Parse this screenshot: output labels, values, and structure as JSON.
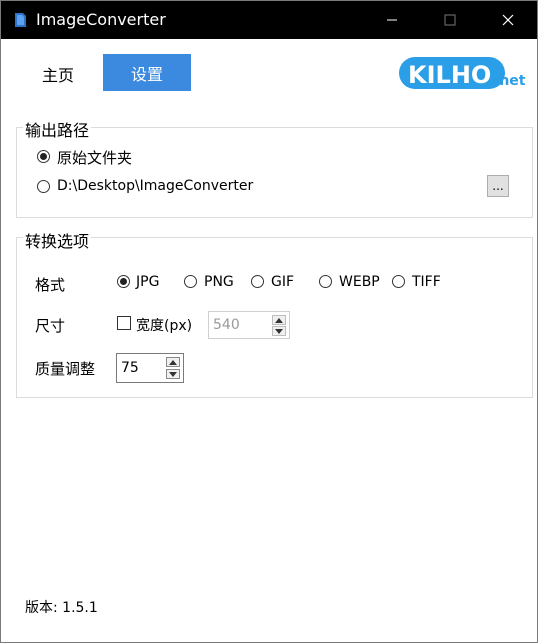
{
  "window": {
    "title": "ImageConverter"
  },
  "nav": {
    "home": "主页",
    "settings": "设置"
  },
  "logo": {
    "main": "KILHO",
    "suffix": ".net"
  },
  "output": {
    "group_label": "输出路径",
    "option_original": "原始文件夹",
    "option_custom": "D:\\Desktop\\ImageConverter",
    "browse": "...",
    "selected": "original"
  },
  "convert": {
    "group_label": "转换选项",
    "format_label": "格式",
    "formats": [
      "JPG",
      "PNG",
      "GIF",
      "WEBP",
      "TIFF"
    ],
    "selected_format": "JPG",
    "size_label": "尺寸",
    "width_label": "宽度(px)",
    "width_checked": false,
    "width_value": "540",
    "quality_label": "质量调整",
    "quality_value": "75"
  },
  "footer": {
    "version": "版本: 1.5.1"
  },
  "colors": {
    "accent": "#3c8ae0",
    "titlebar": "#000000",
    "logo": "#2b9ee8"
  }
}
